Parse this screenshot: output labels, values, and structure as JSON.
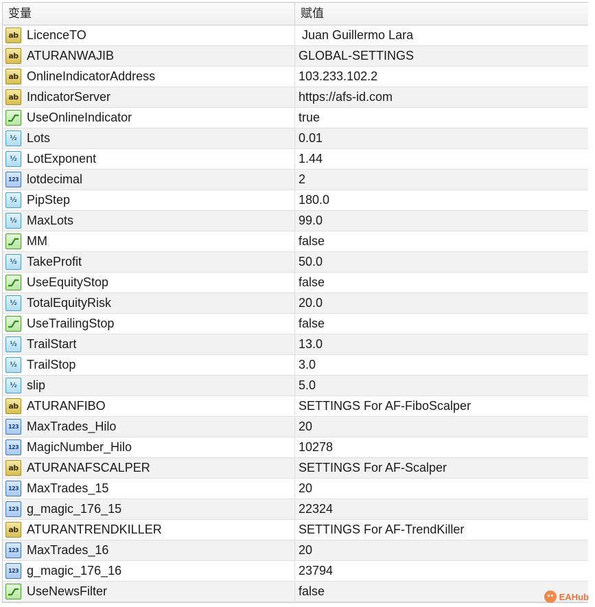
{
  "header": {
    "variable_label": "变量",
    "value_label": "赋值"
  },
  "rows": [
    {
      "name": "LicenceTO",
      "value": " Juan Guillermo Lara",
      "type": "string",
      "icon_text": "ab"
    },
    {
      "name": "ATURANWAJIB",
      "value": "GLOBAL-SETTINGS",
      "type": "string",
      "icon_text": "ab"
    },
    {
      "name": "OnlineIndicatorAddress",
      "value": "103.233.102.2",
      "type": "string",
      "icon_text": "ab"
    },
    {
      "name": "IndicatorServer",
      "value": "https://afs-id.com",
      "type": "string",
      "icon_text": "ab"
    },
    {
      "name": "UseOnlineIndicator",
      "value": "true",
      "type": "bool",
      "icon_text": ""
    },
    {
      "name": "Lots",
      "value": "0.01",
      "type": "double",
      "icon_text": "½"
    },
    {
      "name": "LotExponent",
      "value": "1.44",
      "type": "double",
      "icon_text": "½"
    },
    {
      "name": "lotdecimal",
      "value": "2",
      "type": "int",
      "icon_text": "123"
    },
    {
      "name": "PipStep",
      "value": "180.0",
      "type": "double",
      "icon_text": "½"
    },
    {
      "name": "MaxLots",
      "value": "99.0",
      "type": "double",
      "icon_text": "½"
    },
    {
      "name": "MM",
      "value": "false",
      "type": "bool",
      "icon_text": ""
    },
    {
      "name": "TakeProfit",
      "value": "50.0",
      "type": "double",
      "icon_text": "½"
    },
    {
      "name": "UseEquityStop",
      "value": "false",
      "type": "bool",
      "icon_text": ""
    },
    {
      "name": "TotalEquityRisk",
      "value": "20.0",
      "type": "double",
      "icon_text": "½"
    },
    {
      "name": "UseTrailingStop",
      "value": "false",
      "type": "bool",
      "icon_text": ""
    },
    {
      "name": "TrailStart",
      "value": "13.0",
      "type": "double",
      "icon_text": "½"
    },
    {
      "name": "TrailStop",
      "value": "3.0",
      "type": "double",
      "icon_text": "½"
    },
    {
      "name": "slip",
      "value": "5.0",
      "type": "double",
      "icon_text": "½"
    },
    {
      "name": "ATURANFIBO",
      "value": "SETTINGS For AF-FiboScalper",
      "type": "string",
      "icon_text": "ab"
    },
    {
      "name": "MaxTrades_Hilo",
      "value": "20",
      "type": "int",
      "icon_text": "123"
    },
    {
      "name": "MagicNumber_Hilo",
      "value": "10278",
      "type": "int",
      "icon_text": "123"
    },
    {
      "name": "ATURANAFSCALPER",
      "value": "SETTINGS For AF-Scalper",
      "type": "string",
      "icon_text": "ab"
    },
    {
      "name": "MaxTrades_15",
      "value": "20",
      "type": "int",
      "icon_text": "123"
    },
    {
      "name": "g_magic_176_15",
      "value": "22324",
      "type": "int",
      "icon_text": "123"
    },
    {
      "name": "ATURANTRENDKILLER",
      "value": "SETTINGS For AF-TrendKiller",
      "type": "string",
      "icon_text": "ab"
    },
    {
      "name": "MaxTrades_16",
      "value": "20",
      "type": "int",
      "icon_text": "123"
    },
    {
      "name": "g_magic_176_16",
      "value": "23794",
      "type": "int",
      "icon_text": "123"
    },
    {
      "name": "UseNewsFilter",
      "value": "false",
      "type": "bool",
      "icon_text": ""
    }
  ],
  "watermark": {
    "text": "EAHub",
    "color": "#e8743b"
  }
}
